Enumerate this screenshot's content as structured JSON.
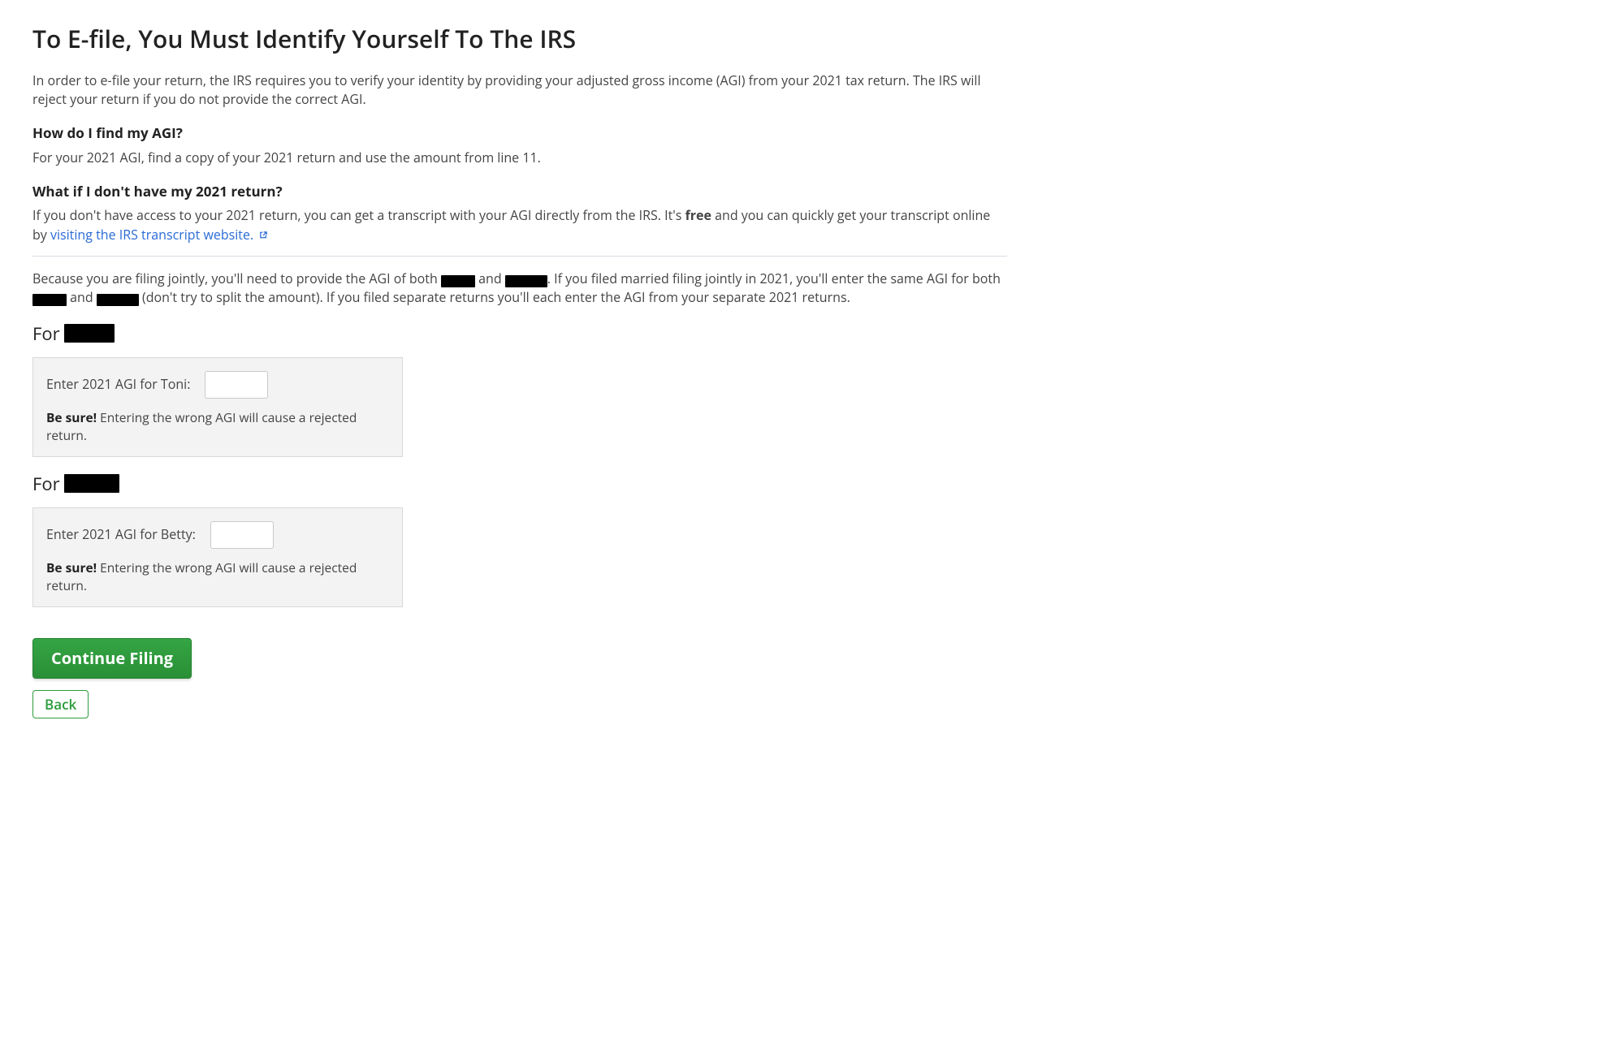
{
  "title": "To E-file, You Must Identify Yourself To The IRS",
  "intro": "In order to e-file your return, the IRS requires you to verify your identity by providing your adjusted gross income (AGI) from your 2021 tax return. The IRS will reject your return if you do not provide the correct AGI.",
  "find": {
    "heading": "How do I find my AGI?",
    "body": "For your 2021 AGI, find a copy of your 2021 return and use the amount from line 11."
  },
  "noreturn": {
    "heading": "What if I don't have my 2021 return?",
    "prefix": "If you don't have access to your 2021 return, you can get a transcript with your AGI directly from the IRS. It's ",
    "bold": "free",
    "mid": " and you can quickly get your transcript online by ",
    "link": "visiting the IRS transcript website."
  },
  "joint": {
    "p1a": "Because you are filing jointly, you'll need to provide the AGI of both ",
    "p1b": " and ",
    "p1c": ". If you filed married filing jointly in 2021, you'll enter the same AGI for both ",
    "p2a": " and ",
    "p2b": " (don't try to split the amount). If you filed separate returns you'll each enter the AGI from your separate 2021 returns."
  },
  "sections": {
    "for_label": "For",
    "p1": {
      "input_label": "Enter 2021 AGI for Toni:",
      "warn_bold": "Be sure!",
      "warn_rest": " Entering the wrong AGI will cause a rejected return."
    },
    "p2": {
      "input_label": "Enter 2021 AGI for Betty:",
      "warn_bold": "Be sure!",
      "warn_rest": " Entering the wrong AGI will cause a rejected return."
    }
  },
  "buttons": {
    "continue": "Continue Filing",
    "back": "Back"
  }
}
